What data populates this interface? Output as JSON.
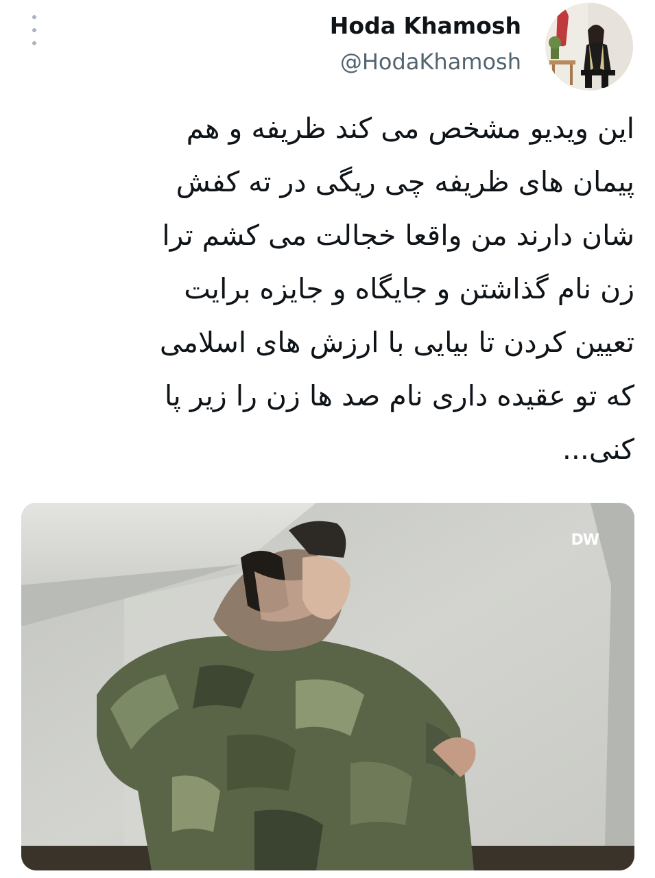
{
  "author": {
    "display_name": "Hoda Khamosh",
    "handle": "@HodaKhamosh"
  },
  "tweet": {
    "lines": [
      "این ویدیو مشخص می کند ظریفه و هم",
      "پیمان های ظریفه چی ریگی در ته کفش",
      "شان دارند من واقعا خجالت می کشم ترا",
      "زن نام گذاشتن و جایگاه و جایزه برایت",
      "تعیین کردن تا بیایی با ارزش های اسلامی",
      "که تو عقیده داری نام صد ها زن را زیر پا",
      "کنی..."
    ]
  },
  "media": {
    "watermark": "DW"
  },
  "icons": {
    "more": "more-vertical-icon"
  },
  "colors": {
    "text": "#0f1419",
    "secondary": "#536471",
    "icon": "#a9b4bf"
  }
}
